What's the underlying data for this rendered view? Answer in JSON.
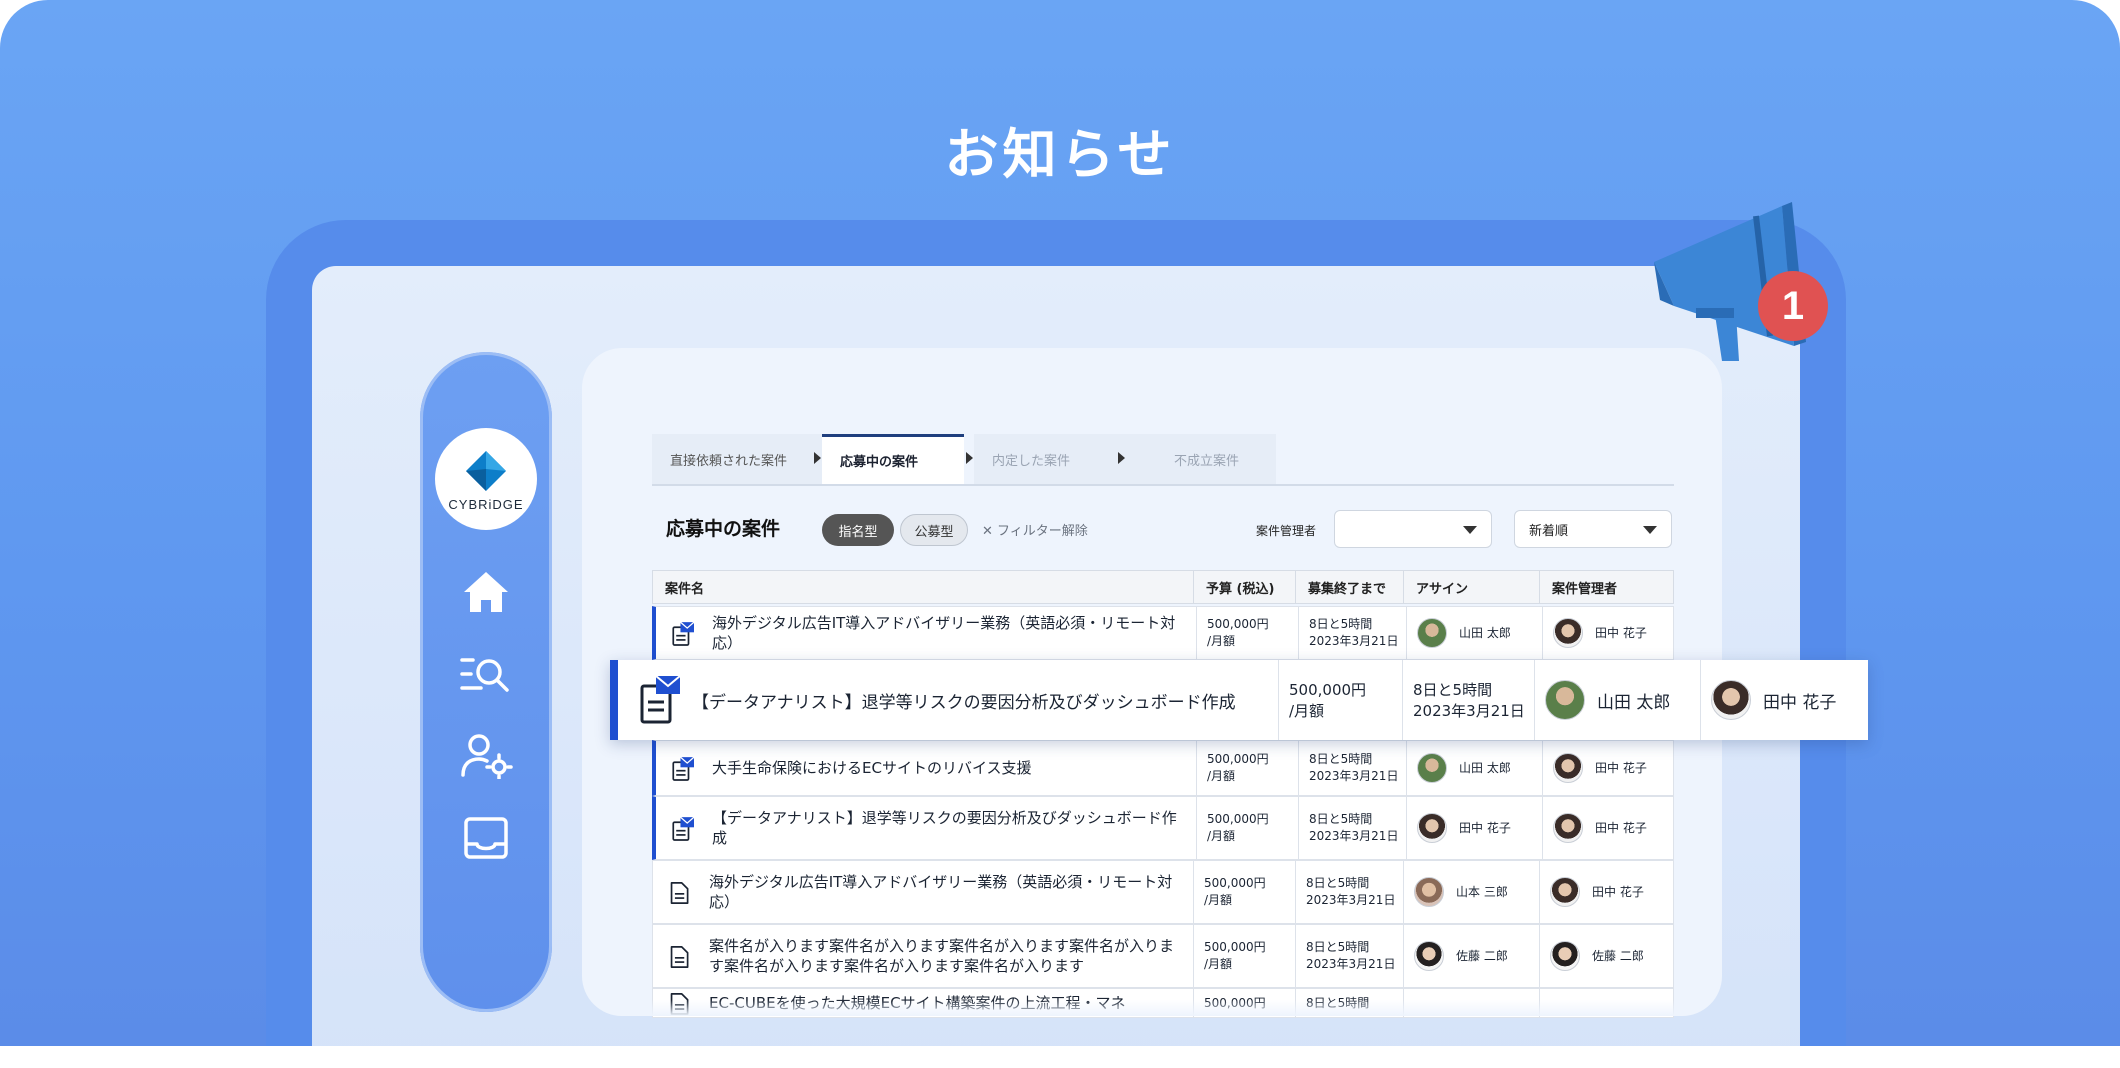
{
  "heading": "お知らせ",
  "logo": {
    "text": "CYBRiDGE"
  },
  "sidebar": {
    "icons": [
      "home-icon",
      "search-list-icon",
      "user-settings-icon",
      "inbox-icon"
    ]
  },
  "badge": {
    "count": "1"
  },
  "tabs": [
    {
      "label": "直接依頼された案件"
    },
    {
      "label": "応募中の案件"
    },
    {
      "label": "内定した案件"
    },
    {
      "label": "不成立案件"
    }
  ],
  "list": {
    "title": "応募中の案件",
    "chip_nominated": "指名型",
    "chip_public": "公募型",
    "clear_filter": "フィルター解除",
    "manager_label": "案件管理者",
    "manager_select": "",
    "sort_select": "新着順"
  },
  "columns": {
    "name": "案件名",
    "budget": "予算 (税込)",
    "deadline": "募集終了まで",
    "assign": "アサイン",
    "manager": "案件管理者"
  },
  "rows": [
    {
      "title": "海外デジタル広告IT導入アドバイザリー業務（英語必須・リモート対応）",
      "budget": "500,000円",
      "budget_unit": "/月額",
      "remain": "8日と5時間",
      "date": "2023年3月21日",
      "assignee": "山田 太郎",
      "manager": "田中 花子",
      "unread": true
    },
    {
      "title": "大手生命保険におけるECサイトのリバイス支援",
      "budget": "500,000円",
      "budget_unit": "/月額",
      "remain": "8日と5時間",
      "date": "2023年3月21日",
      "assignee": "山田 太郎",
      "manager": "田中 花子",
      "unread": true
    },
    {
      "title": "【データアナリスト】退学等リスクの要因分析及びダッシュボード作成",
      "budget": "500,000円",
      "budget_unit": "/月額",
      "remain": "8日と5時間",
      "date": "2023年3月21日",
      "assignee": "田中 花子",
      "manager": "田中 花子",
      "unread": true
    },
    {
      "title": "海外デジタル広告IT導入アドバイザリー業務（英語必須・リモート対応）",
      "budget": "500,000円",
      "budget_unit": "/月額",
      "remain": "8日と5時間",
      "date": "2023年3月21日",
      "assignee": "山本 三郎",
      "manager": "田中 花子",
      "unread": false
    },
    {
      "title": "案件名が入ります案件名が入ります案件名が入ります案件名が入ります案件名が入ります案件名が入ります案件名が入ります",
      "budget": "500,000円",
      "budget_unit": "/月額",
      "remain": "8日と5時間",
      "date": "2023年3月21日",
      "assignee": "佐藤 二郎",
      "manager": "佐藤 二郎",
      "unread": false
    },
    {
      "title": "EC-CUBEを使った大規模ECサイト構築案件の上流工程・マネ",
      "budget": "500,000円",
      "budget_unit": "",
      "remain": "8日と5時間",
      "date": "",
      "assignee": "",
      "manager": "",
      "unread": false
    }
  ],
  "popout": {
    "title": "【データアナリスト】退学等リスクの要因分析及びダッシュボード作成",
    "budget": "500,000円",
    "budget_unit": "/月額",
    "remain": "8日と5時間",
    "date": "2023年3月21日",
    "assignee": "山田 太郎",
    "manager": "田中 花子"
  }
}
